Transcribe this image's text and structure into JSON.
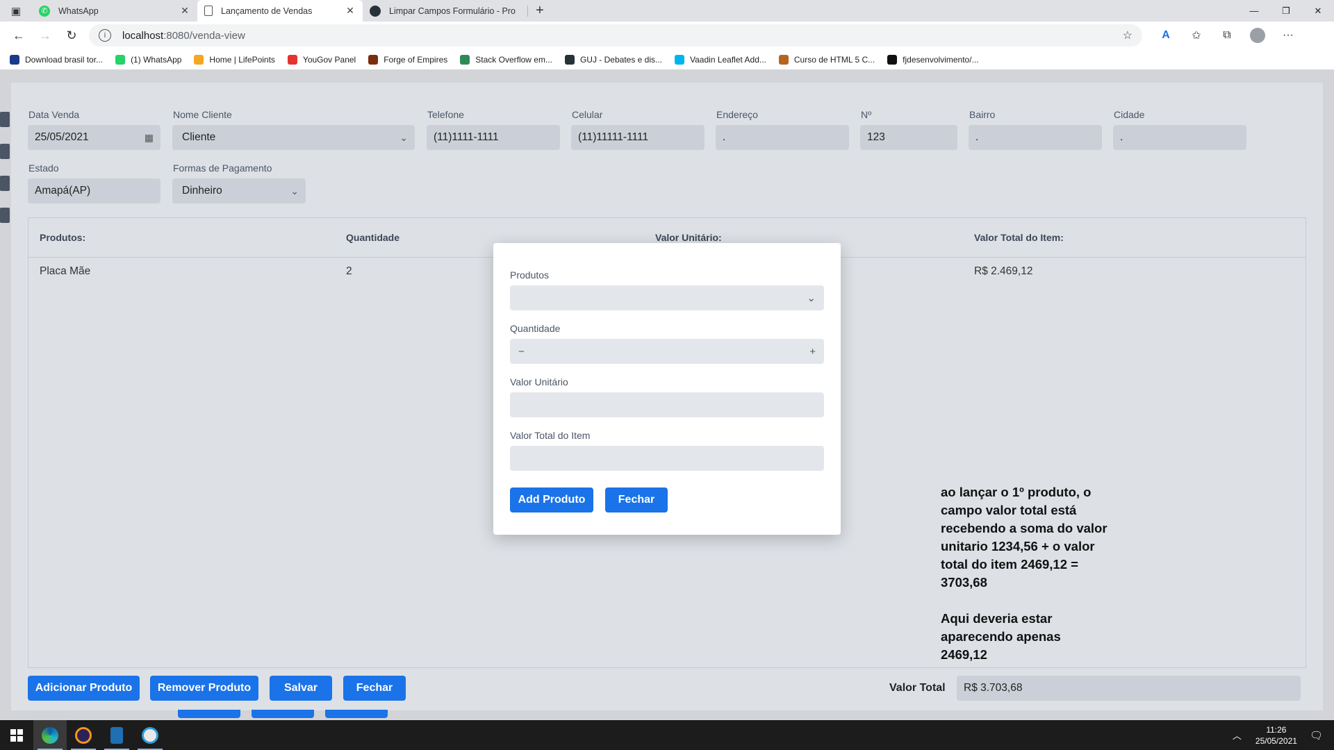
{
  "browser": {
    "tabs": [
      {
        "title": "WhatsApp",
        "active": false
      },
      {
        "title": "Lançamento de Vendas",
        "active": true
      },
      {
        "title": "Limpar Campos Formulário - Pro",
        "active": false
      }
    ],
    "url_host": "localhost",
    "url_path": ":8080/venda-view",
    "bookmarks": [
      {
        "label": "Download brasil tor...",
        "icon": "r-letter-icon",
        "color": "#1a3a8a"
      },
      {
        "label": "(1) WhatsApp",
        "icon": "whatsapp-icon",
        "color": "#25d366"
      },
      {
        "label": "Home | LifePoints",
        "icon": "sun-icon",
        "color": "#f5a623"
      },
      {
        "label": "YouGov Panel",
        "icon": "yougov-icon",
        "color": "#e3342f"
      },
      {
        "label": "Forge of Empires",
        "icon": "forge-icon",
        "color": "#7a2e0e"
      },
      {
        "label": "Stack Overflow em...",
        "icon": "stackoverflow-icon",
        "color": "#2e8b57"
      },
      {
        "label": "GUJ - Debates e dis...",
        "icon": "guj-icon",
        "color": "#263238"
      },
      {
        "label": "Vaadin Leaflet Add...",
        "icon": "vaadin-icon",
        "color": "#00b4f0"
      },
      {
        "label": "Curso de HTML 5 C...",
        "icon": "eye-icon",
        "color": "#b5651d"
      },
      {
        "label": "fjdesenvolvimento/...",
        "icon": "github-icon",
        "color": "#111111"
      }
    ]
  },
  "form": {
    "data_venda": {
      "label": "Data Venda",
      "value": "25/05/2021"
    },
    "nome_cliente": {
      "label": "Nome Cliente",
      "value": "Cliente"
    },
    "telefone": {
      "label": "Telefone",
      "value": "(11)1111-1111"
    },
    "celular": {
      "label": "Celular",
      "value": "(11)11111-1111"
    },
    "endereco": {
      "label": "Endereço",
      "value": "."
    },
    "numero": {
      "label": "Nº",
      "value": "123"
    },
    "bairro": {
      "label": "Bairro",
      "value": "."
    },
    "cidade": {
      "label": "Cidade",
      "value": "."
    },
    "estado": {
      "label": "Estado",
      "value": "Amapá(AP)"
    },
    "pagamento": {
      "label": "Formas de Pagamento",
      "value": "Dinheiro"
    }
  },
  "grid": {
    "headers": [
      "Produtos:",
      "Quantidade",
      "Valor Unitário:",
      "Valor Total do Item:"
    ],
    "rows": [
      {
        "produto": "Placa Mãe",
        "quantidade": "2",
        "valor_total": "R$ 2.469,12"
      }
    ]
  },
  "actions": {
    "adicionar": "Adicionar Produto",
    "remover": "Remover Produto",
    "salvar": "Salvar",
    "fechar": "Fechar"
  },
  "total": {
    "label": "Valor Total",
    "value": "R$ 3.703,68"
  },
  "dialog": {
    "produtos_label": "Produtos",
    "quantidade_label": "Quantidade",
    "valor_unitario_label": "Valor Unitário",
    "valor_total_label": "Valor Total do Item",
    "add_button": "Add Produto",
    "close_button": "Fechar"
  },
  "annotation": {
    "line1": "ao lançar o 1º produto, o campo valor total está recebendo a soma do valor unitario 1234,56 + o valor total do item 2469,12 = 3703,68",
    "line2": "Aqui deveria estar aparecendo apenas 2469,12"
  },
  "taskbar": {
    "time": "11:26",
    "date": "25/05/2021"
  }
}
